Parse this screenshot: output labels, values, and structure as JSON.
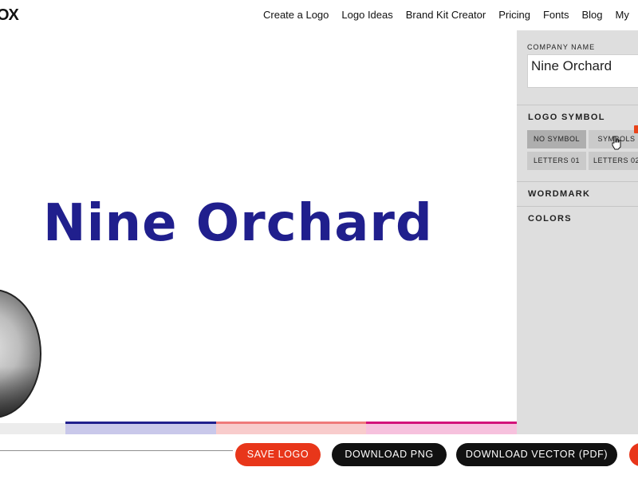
{
  "header": {
    "logo": "OX",
    "nav": [
      "Create a Logo",
      "Logo Ideas",
      "Brand Kit Creator",
      "Pricing",
      "Fonts",
      "Blog",
      "My"
    ]
  },
  "canvas": {
    "wordmark": "Nine Orchard",
    "wordmark_color": "#201f8d",
    "palette": [
      "#201f8d",
      "#ef7b7b",
      "#d3127a"
    ]
  },
  "panel": {
    "company_label": "COMPANY NAME",
    "company_value": "Nine Orchard",
    "logo_symbol_title": "LOGO SYMBOL",
    "symbol_options": [
      "NO SYMBOL",
      "SYMBOLS",
      "LETTERS 01",
      "LETTERS 02"
    ],
    "selected_symbol": "NO SYMBOL",
    "wordmark_title": "WORDMARK",
    "colors_title": "COLORS"
  },
  "actions": {
    "save": "SAVE LOGO",
    "download_png": "DOWNLOAD PNG",
    "download_vector": "DOWNLOAD VECTOR (PDF)"
  },
  "colors": {
    "accent_red": "#e8361a",
    "dark_button": "#111111",
    "panel_bg": "#dedede"
  }
}
